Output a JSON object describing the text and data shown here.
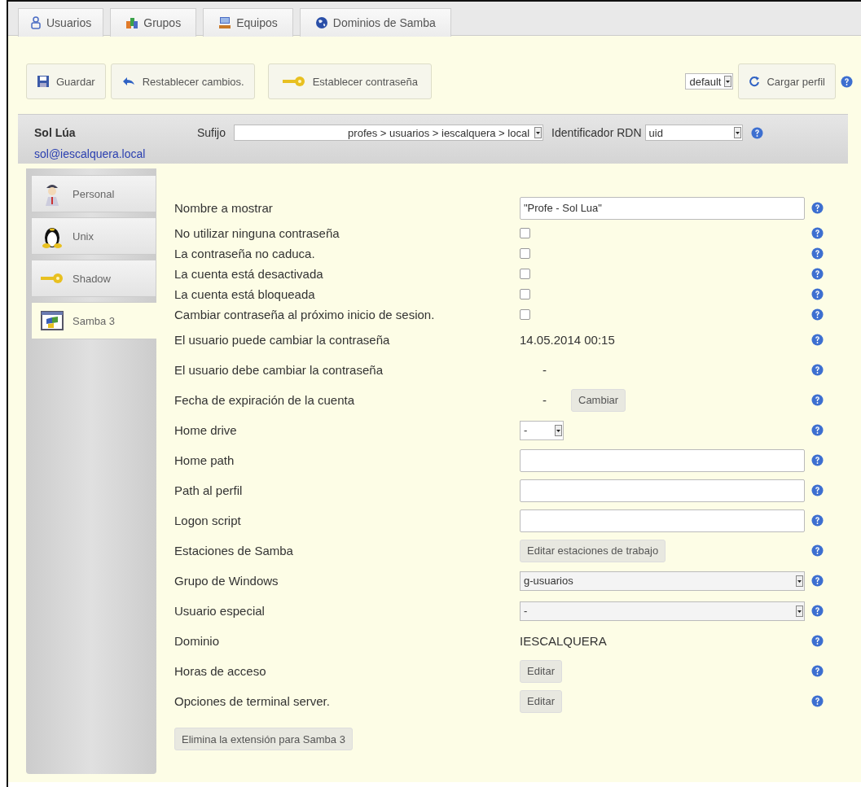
{
  "tabs": [
    {
      "label": "Usuarios"
    },
    {
      "label": "Grupos"
    },
    {
      "label": "Equipos"
    },
    {
      "label": "Dominios de Samba"
    }
  ],
  "toolbar": {
    "buttons": [
      {
        "label": "Guardar"
      },
      {
        "label": "Restablecer cambios."
      },
      {
        "label": "Establecer contraseña"
      }
    ],
    "profile_select": "default",
    "load_button": "Cargar perfil"
  },
  "account": {
    "name": "Sol Lúa",
    "email": "sol@iescalquera.local",
    "suffix_label": "Sufijo",
    "suffix": "profes > usuarios > iescalquera > local",
    "rdn_label": "Identificador RDN",
    "rdn": "uid"
  },
  "modules": [
    {
      "label": "Personal",
      "selected": false
    },
    {
      "label": "Unix",
      "selected": false
    },
    {
      "label": "Shadow",
      "selected": false
    },
    {
      "label": "Samba 3",
      "selected": true
    }
  ],
  "fields": [
    {
      "kind": "input",
      "label": "Nombre a mostrar",
      "value": "\"Profe - Sol Lua\""
    },
    {
      "kind": "checkbox",
      "label": "No utilizar ninguna contraseña",
      "checked": false
    },
    {
      "kind": "checkbox",
      "label": "La contraseña no caduca.",
      "checked": false
    },
    {
      "kind": "checkbox",
      "label": "La cuenta está desactivada",
      "checked": false
    },
    {
      "kind": "checkbox",
      "label": "La cuenta está bloqueada",
      "checked": false
    },
    {
      "kind": "checkbox",
      "label": "Cambiar contraseña al próximo inicio de sesion.",
      "checked": false
    },
    {
      "kind": "text",
      "label": "El usuario puede cambiar la contraseña",
      "value": "14.05.2014 00:15"
    },
    {
      "kind": "text",
      "label": "El usuario debe cambiar la contraseña",
      "value": "-"
    },
    {
      "kind": "text_button",
      "label": "Fecha de expiración de la cuenta",
      "value": "-",
      "button": "Cambiar"
    },
    {
      "kind": "small_select",
      "label": "Home drive",
      "value": "-"
    },
    {
      "kind": "input",
      "label": "Home path"
    },
    {
      "kind": "input",
      "label": "Path al perfil"
    },
    {
      "kind": "input",
      "label": "Logon script"
    },
    {
      "kind": "button",
      "label": "Estaciones de Samba",
      "button": "Editar estaciones de trabajo"
    },
    {
      "kind": "select",
      "label": "Grupo de Windows",
      "value": "g-usuarios"
    },
    {
      "kind": "select",
      "label": "Usuario especial",
      "value": "-"
    },
    {
      "kind": "text",
      "label": "Dominio",
      "value": "IESCALQUERA"
    },
    {
      "kind": "button",
      "label": "Horas de acceso",
      "button": "Editar"
    },
    {
      "kind": "button",
      "label": "Opciones de terminal server.",
      "button": "Editar"
    }
  ],
  "remove_button": "Elimina la extensión para Samba 3"
}
